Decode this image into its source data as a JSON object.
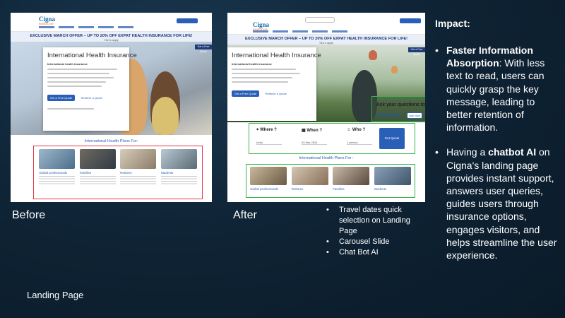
{
  "before": {
    "label": "Before",
    "logo": "Cigna",
    "logo_tag": "healthcare",
    "banner": "EXCLUSIVE MARCH OFFER – UP TO 20% OFF EXPAT HEALTH INSURANCE FOR LIFE!",
    "banner_sub": "T&C's apply",
    "hero_cta_tab": "Get a Free Quote",
    "card": {
      "title": "International Health Insurance",
      "subtitle": "International health insurance",
      "cta": "Get a Free Quote",
      "cta2": "Retrieve a Quote"
    },
    "plans_title": "International Health Plans For:",
    "plans": [
      {
        "title": "Global professionals"
      },
      {
        "title": "Families"
      },
      {
        "title": "Retirees"
      },
      {
        "title": "Students"
      }
    ]
  },
  "after": {
    "label": "After",
    "logo": "Cigna",
    "logo_tag": "healthcare",
    "banner": "EXCLUSIVE MARCH OFFER – UP TO 20% OFF EXPAT HEALTH INSURANCE FOR LIFE!",
    "banner_sub": "T&C's apply",
    "hero_cta_tab": "Get a Free Quote",
    "card": {
      "title": "International Health Insurance",
      "subtitle": "International health insurance",
      "cta": "Get a Free Quote",
      "cta2": "Retrieve a Quote"
    },
    "chat": {
      "prompt": "Ask your questions to",
      "bot": "Chat bot AI",
      "chip": "Ask Now"
    },
    "travel": {
      "where": "Where ?",
      "when": "When ?",
      "who": "Who ?",
      "where_val": "India",
      "when_val": "04 Mar 2024",
      "who_val": "1 person",
      "go": "Get Quote"
    },
    "plans_title": "International Health Plans For :",
    "plans": [
      {
        "title": "Global professionals"
      },
      {
        "title": "Retirees"
      },
      {
        "title": "Families"
      },
      {
        "title": "Students"
      }
    ]
  },
  "landing_label": "Landing Page",
  "changes": [
    "Travel dates quick selection on Landing Page",
    "Carousel Slide",
    "Chat Bot AI"
  ],
  "impact": {
    "title": "Impact:",
    "p1_bold": "Faster Information Absorption",
    "p1_rest": ": With less text to read, users can quickly grasp the key message, leading to better retention of information.",
    "p2_start": "Having a ",
    "p2_bold": "chatbot AI",
    "p2_rest": " on Cigna's landing page provides instant support, answers user queries, guides users through insurance options, engages visitors, and helps streamline the user experience."
  }
}
